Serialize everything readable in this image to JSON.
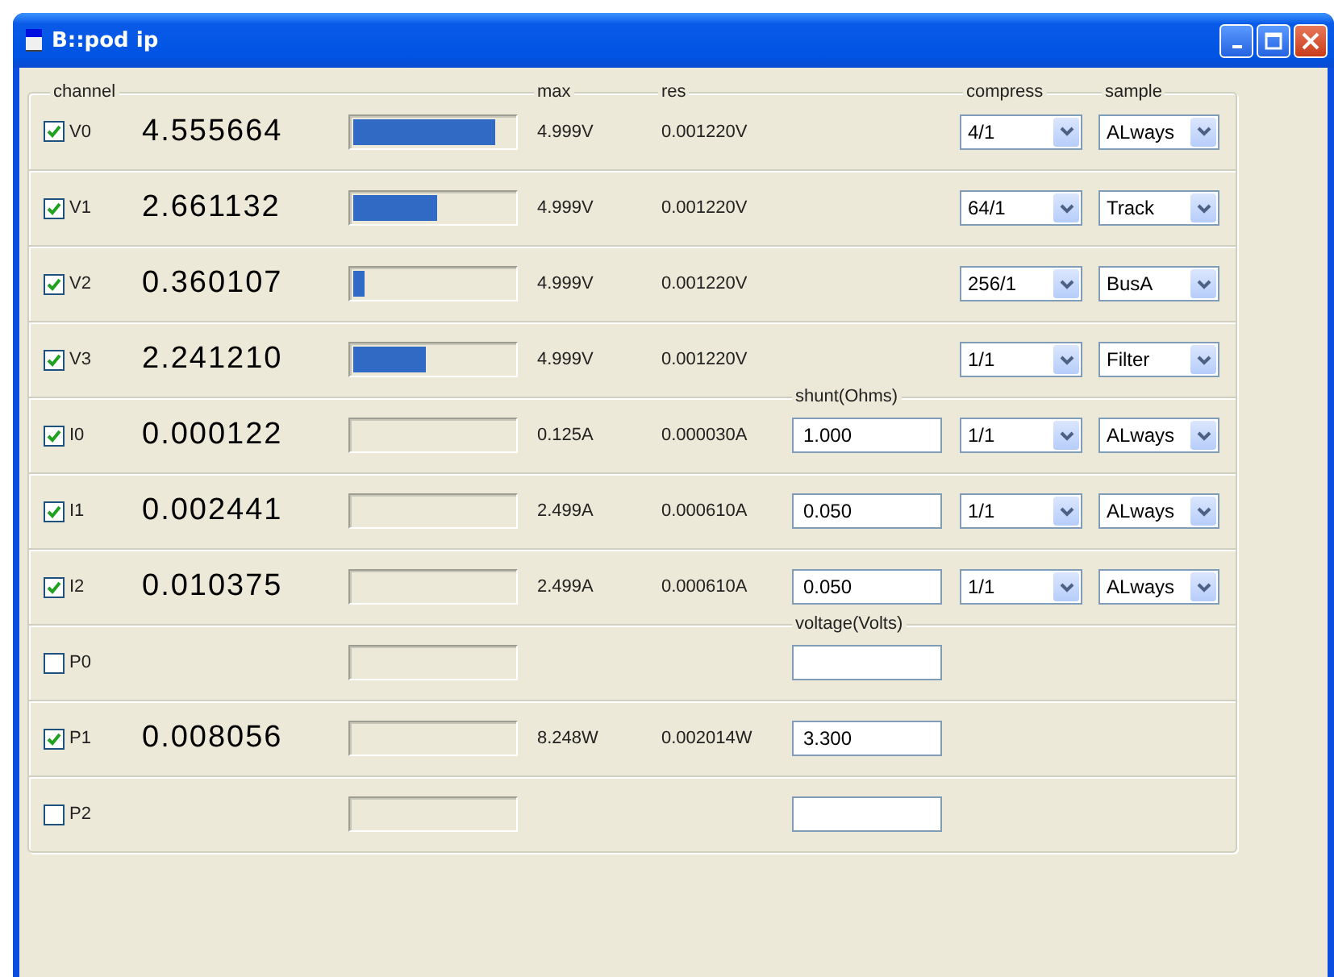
{
  "window": {
    "title": "B::pod ip"
  },
  "headers": {
    "channel": "channel",
    "max": "max",
    "res": "res",
    "compress": "compress",
    "sample": "sample"
  },
  "rows": [
    {
      "kind": "meter",
      "name": "V0",
      "checked": true,
      "value": "4.555664",
      "level": 0.89,
      "max": "4.999V",
      "res": "0.001220V",
      "compress": "4/1",
      "sample": "ALways"
    },
    {
      "kind": "meter",
      "name": "V1",
      "checked": true,
      "value": "2.661132",
      "level": 0.53,
      "max": "4.999V",
      "res": "0.001220V",
      "compress": "64/1",
      "sample": "Track"
    },
    {
      "kind": "meter",
      "name": "V2",
      "checked": true,
      "value": "0.360107",
      "level": 0.07,
      "max": "4.999V",
      "res": "0.001220V",
      "compress": "256/1",
      "sample": "BusA"
    },
    {
      "kind": "meter",
      "name": "V3",
      "checked": true,
      "value": "2.241210",
      "level": 0.45,
      "max": "4.999V",
      "res": "0.001220V",
      "compress": "1/1",
      "sample": "Filter"
    },
    {
      "kind": "shunt",
      "section_label": "shunt(Ohms)",
      "name": "I0",
      "checked": true,
      "value": "0.000122",
      "max": "0.125A",
      "res": "0.000030A",
      "field": "1.000",
      "compress": "1/1",
      "sample": "ALways"
    },
    {
      "kind": "shunt",
      "name": "I1",
      "checked": true,
      "value": "0.002441",
      "max": "2.499A",
      "res": "0.000610A",
      "field": "0.050",
      "compress": "1/1",
      "sample": "ALways"
    },
    {
      "kind": "shunt",
      "name": "I2",
      "checked": true,
      "value": "0.010375",
      "max": "2.499A",
      "res": "0.000610A",
      "field": "0.050",
      "compress": "1/1",
      "sample": "ALways"
    },
    {
      "kind": "power",
      "section_label": "voltage(Volts)",
      "name": "P0",
      "checked": false
    },
    {
      "kind": "power",
      "name": "P1",
      "checked": true,
      "value": "0.008056",
      "max": "8.248W",
      "res": "0.002014W",
      "field": "3.300"
    },
    {
      "kind": "power",
      "name": "P2",
      "checked": false
    }
  ]
}
